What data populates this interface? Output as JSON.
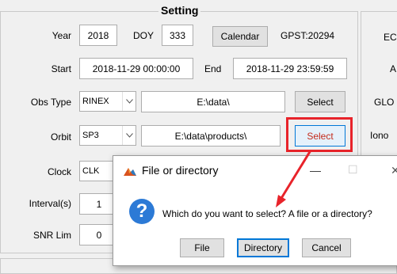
{
  "setting_panel": {
    "title": "Setting",
    "year_label": "Year",
    "year_value": "2018",
    "doy_label": "DOY",
    "doy_value": "333",
    "calendar_button": "Calendar",
    "gpst_label": "GPST:20294",
    "start_label": "Start",
    "start_value": "2018-11-29 00:00:00",
    "end_label": "End",
    "end_value": "2018-11-29 23:59:59",
    "obs_type_label": "Obs Type",
    "obs_type_selected": "RINEX",
    "obs_path": "E:\\data\\",
    "obs_select_button": "Select",
    "orbit_label": "Orbit",
    "orbit_selected": "SP3",
    "orbit_path": "E:\\data\\products\\",
    "orbit_select_button": "Select",
    "clock_label": "Clock",
    "clock_selected": "CLK",
    "interval_label": "Interval(s)",
    "interval_value": "1",
    "snr_label": "SNR Lim",
    "snr_value": "0"
  },
  "right_panel": {
    "labels": [
      "EC",
      "A",
      "GLO",
      "Iono"
    ]
  },
  "dialog": {
    "title": "File or directory",
    "message": "Which do you want to select? A file or a directory?",
    "file_button": "File",
    "directory_button": "Directory",
    "cancel_button": "Cancel",
    "minimize_glyph": "—",
    "maximize_glyph": "☐",
    "close_glyph": "✕"
  },
  "colors": {
    "highlight": "#e8232a",
    "window_bg": "#f0f0f0",
    "accent": "#0078d7"
  }
}
